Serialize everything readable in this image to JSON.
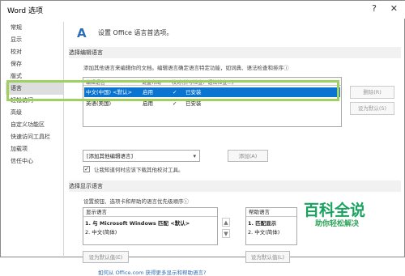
{
  "window": {
    "title": "Word 选项",
    "help_icon": "?",
    "close_icon": "✕"
  },
  "sidebar": {
    "items": [
      "常规",
      "显示",
      "校对",
      "保存",
      "版式",
      "语言",
      "轻松访问",
      "高级",
      "自定义功能区",
      "快速访问工具栏",
      "加载项",
      "信任中心"
    ],
    "selected": "语言"
  },
  "main": {
    "heading": "设置 Office 语言首选项。",
    "editing": {
      "section_title": "选择编辑语言",
      "description": "添加其他语言来编辑你的文档。编辑语言确定语言特定功能，如词典、语法检查和排序ⓘ",
      "headers": [
        "编辑语言",
        "键盘布局",
        "校对(拼写检查、语法检查...)"
      ],
      "rows": [
        {
          "language": "中文(中国) <默认>",
          "keyboard": "启用",
          "proofing": "已安装"
        },
        {
          "language": "英语(美国)",
          "keyboard": "启用",
          "proofing": "已安装"
        }
      ],
      "remove_button": "删除(R)",
      "set_default_button": "设为默认(S)",
      "add_select": "[添加其他编辑语言]",
      "add_button": "添加(A)",
      "checkbox_label": "让我知道何时应该下载其他校对工具。"
    },
    "display": {
      "section_title": "选择显示语言",
      "description": "设置按钮、选项卡和帮助的语言优先级顺序ⓘ",
      "left_title": "显示语言",
      "left_items": [
        "1.  与 Microsoft Windows 匹配 <默认>",
        "2.  中文(简体)"
      ],
      "right_title": "帮助语言",
      "right_items": [
        "1.  匹配显示",
        "2.  中文(简体)"
      ],
      "left_set_default": "设为默认值(E)",
      "right_set_default": "设为默认值(L)"
    },
    "link": "如何从 Office.com 获得更多显示和帮助语言?"
  },
  "watermark": {
    "main": "百科全说",
    "sub": "助你轻松解决"
  },
  "colors": {
    "selection": "#0b74d0",
    "highlight": "#a0d060",
    "link": "#2f6db5"
  }
}
